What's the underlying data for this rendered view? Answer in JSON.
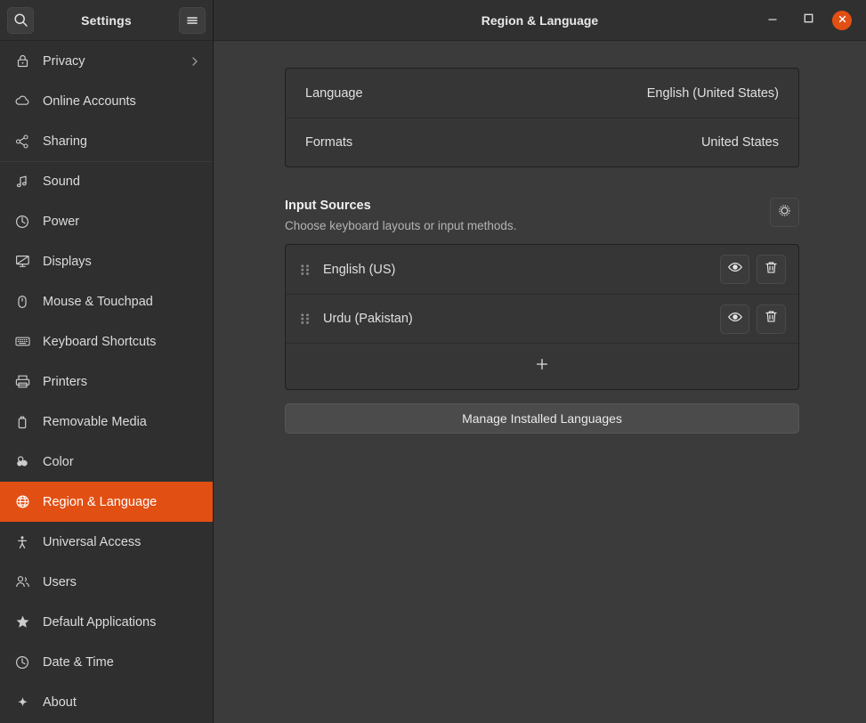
{
  "window": {
    "title": "Region & Language",
    "minimize_label": "Minimize",
    "maximize_label": "Maximize",
    "close_label": "Close"
  },
  "sidebar": {
    "app_title": "Settings",
    "search_label": "Search",
    "menu_label": "Main Menu",
    "items": [
      {
        "label": "Privacy",
        "icon": "lock-icon",
        "chevron": true,
        "active": false,
        "separator_above": false
      },
      {
        "label": "Online Accounts",
        "icon": "cloud-icon",
        "chevron": false,
        "active": false,
        "separator_above": false
      },
      {
        "label": "Sharing",
        "icon": "share-nodes-icon",
        "chevron": false,
        "active": false,
        "separator_above": false
      },
      {
        "label": "Sound",
        "icon": "music-note-icon",
        "chevron": false,
        "active": false,
        "separator_above": true
      },
      {
        "label": "Power",
        "icon": "power-icon",
        "chevron": false,
        "active": false,
        "separator_above": false
      },
      {
        "label": "Displays",
        "icon": "display-icon",
        "chevron": false,
        "active": false,
        "separator_above": false
      },
      {
        "label": "Mouse & Touchpad",
        "icon": "mouse-icon",
        "chevron": false,
        "active": false,
        "separator_above": false
      },
      {
        "label": "Keyboard Shortcuts",
        "icon": "keyboard-icon",
        "chevron": false,
        "active": false,
        "separator_above": false
      },
      {
        "label": "Printers",
        "icon": "printer-icon",
        "chevron": false,
        "active": false,
        "separator_above": false
      },
      {
        "label": "Removable Media",
        "icon": "usb-drive-icon",
        "chevron": false,
        "active": false,
        "separator_above": false
      },
      {
        "label": "Color",
        "icon": "color-circles-icon",
        "chevron": false,
        "active": false,
        "separator_above": false
      },
      {
        "label": "Region & Language",
        "icon": "globe-icon",
        "chevron": false,
        "active": true,
        "separator_above": false
      },
      {
        "label": "Universal Access",
        "icon": "accessibility-icon",
        "chevron": false,
        "active": false,
        "separator_above": false
      },
      {
        "label": "Users",
        "icon": "users-icon",
        "chevron": false,
        "active": false,
        "separator_above": false
      },
      {
        "label": "Default Applications",
        "icon": "star-icon",
        "chevron": false,
        "active": false,
        "separator_above": false
      },
      {
        "label": "Date & Time",
        "icon": "clock-icon",
        "chevron": false,
        "active": false,
        "separator_above": false
      },
      {
        "label": "About",
        "icon": "sparkle-icon",
        "chevron": false,
        "active": false,
        "separator_above": false
      }
    ]
  },
  "main": {
    "locale_card": {
      "rows": [
        {
          "label": "Language",
          "value": "English (United States)"
        },
        {
          "label": "Formats",
          "value": "United States"
        }
      ]
    },
    "input_sources": {
      "title": "Input Sources",
      "subtitle": "Choose keyboard layouts or input methods.",
      "options_button_label": "Input Source Options",
      "sources": [
        {
          "name": "English (US)",
          "preview_label": "Preview layout",
          "remove_label": "Remove"
        },
        {
          "name": "Urdu (Pakistan)",
          "preview_label": "Preview layout",
          "remove_label": "Remove"
        }
      ],
      "add_label": "+"
    },
    "manage_button_label": "Manage Installed Languages"
  },
  "colors": {
    "accent": "#e24f13",
    "sidebar_bg": "#2f2f2f",
    "main_bg": "#3b3b3b",
    "card_bg": "#363636",
    "header_bg": "#303030"
  }
}
